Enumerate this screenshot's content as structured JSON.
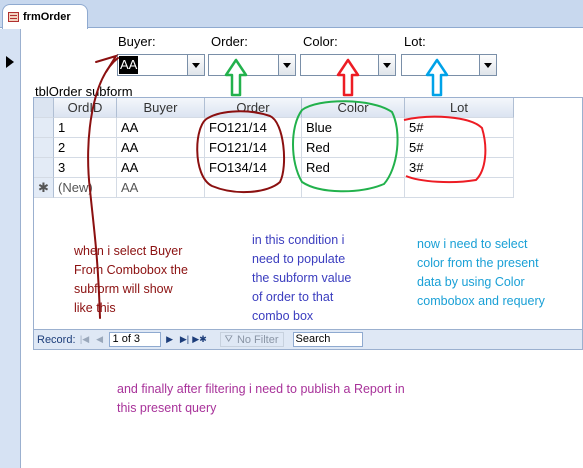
{
  "tab": {
    "title": "frmOrder"
  },
  "filters": {
    "buyer": {
      "label": "Buyer:",
      "value": "AA"
    },
    "order": {
      "label": "Order:",
      "value": ""
    },
    "color": {
      "label": "Color:",
      "value": ""
    },
    "lot": {
      "label": "Lot:",
      "value": ""
    }
  },
  "subform": {
    "label": "tblOrder subform",
    "columns": [
      "OrdID",
      "Buyer",
      "Order",
      "Color",
      "Lot"
    ],
    "rows": [
      {
        "selector": "",
        "ordid": "1",
        "buyer": "AA",
        "order": "FO121/14",
        "color": "Blue",
        "lot": "5#"
      },
      {
        "selector": "",
        "ordid": "2",
        "buyer": "AA",
        "order": "FO121/14",
        "color": "Red",
        "lot": "5#"
      },
      {
        "selector": "",
        "ordid": "3",
        "buyer": "AA",
        "order": "FO134/14",
        "color": "Red",
        "lot": "3#"
      }
    ],
    "new_row": {
      "selector": "✱",
      "ordid": "(New)",
      "buyer": "AA",
      "order": "",
      "color": "",
      "lot": ""
    }
  },
  "navigation": {
    "record_label": "Record:",
    "record_position": "1 of 3",
    "filter_label": "No Filter",
    "search_label": "Search"
  },
  "annotations": {
    "buyer_note": "when i select Buyer\nFrom Combobox the\nsubform will show\nlike this",
    "order_note": "in this condition i\nneed to populate\nthe subform value\nof order to that\ncombo box",
    "color_note": "now i need to select\ncolor from the present\ndata by using Color\ncombobox and requery",
    "report_note": "and finally after filtering i need to publish a Report in\nthis present query"
  },
  "colors": {
    "buyer_annotation": "#8b1010",
    "order_annotation": "#3b3dbf",
    "color_annotation": "#1aa0d6",
    "green_arrow": "#22b14c",
    "red_arrow": "#ed1c24",
    "blue_arrow": "#00a2e8",
    "report_annotation": "#a8329a"
  }
}
